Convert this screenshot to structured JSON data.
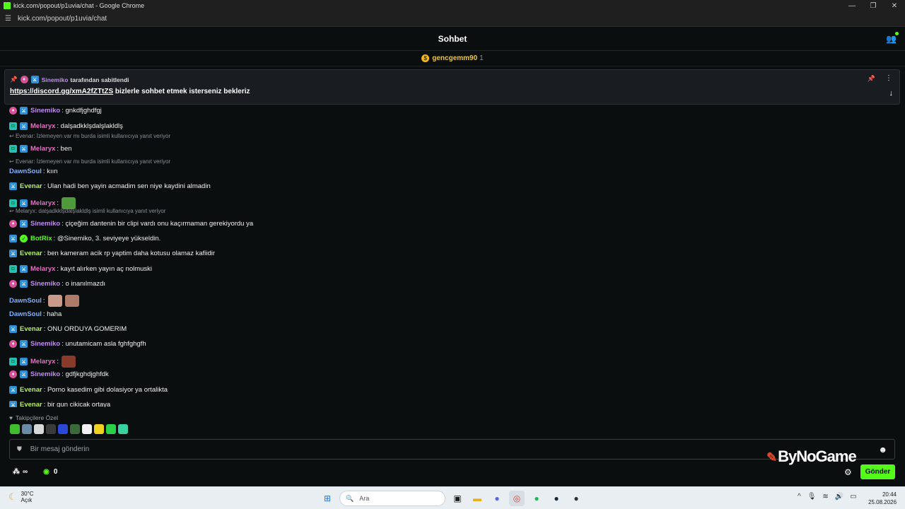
{
  "window": {
    "title": "kick.com/popout/p1uvia/chat - Google Chrome",
    "url": "kick.com/popout/p1uvia/chat"
  },
  "header": {
    "title": "Sohbet"
  },
  "gifter": {
    "name": "gencgemm90",
    "count": "1"
  },
  "pinned": {
    "by_user": "Sinemiko",
    "by_text": "tarafından sabitlendi",
    "link": "https://discord.gg/xmA2fZTtZS",
    "text": " bizlerle sohbet etmek isterseniz bekleriz"
  },
  "messages": [
    {
      "user": "Sinemiko",
      "color": "#c18cf0",
      "text": ": gnkdfjghdfgj",
      "badges": [
        "pink",
        "sword"
      ]
    },
    {
      "user": "Melaryx",
      "color": "#e86cc4",
      "text": ": dalşadkklşdalşlakldlş",
      "badges": [
        "sub",
        "sword"
      ]
    },
    {
      "reply": "Evenar: İzlemeyen var mı burda isimli kullanıcıya yanıt veriyor"
    },
    {
      "user": "Melaryx",
      "color": "#e86cc4",
      "text": ": ben",
      "badges": [
        "sub",
        "sword"
      ]
    },
    {
      "reply": "Evenar: İzlemeyen var mı burda isimli kullanıcıya yanıt veriyor"
    },
    {
      "user": "DawnSoul",
      "color": "#7fb0ff",
      "text": ": kıın",
      "badges": []
    },
    {
      "user": "Evenar",
      "color": "#b6f05a",
      "text": ": Ulan hadi ben yayin acmadim sen niye kaydini almadin",
      "badges": [
        "sword"
      ]
    },
    {
      "user": "Melaryx",
      "color": "#e86cc4",
      "text": ":",
      "badges": [
        "sub",
        "sword"
      ],
      "emote": "#4f9a3a"
    },
    {
      "reply": "Melaryx: dalşadkklşdalşlakldlş isimli kullanıcıya yanıt veriyor"
    },
    {
      "user": "Sinemiko",
      "color": "#c18cf0",
      "text": ": çiçeğim dantenin bir clipi vardı onu kaçırmaman gerekiyordu ya",
      "badges": [
        "pink",
        "sword"
      ]
    },
    {
      "user": "BotRix",
      "color": "#53fc18",
      "text": ": @Sinemiko, 3. seviyeye yükseldin.",
      "badges": [
        "sword",
        "ok"
      ]
    },
    {
      "user": "Evenar",
      "color": "#b6f05a",
      "text": ": ben kameram acik rp yaptim daha kotusu olamaz kafiidir",
      "badges": [
        "sword"
      ]
    },
    {
      "user": "Melaryx",
      "color": "#e86cc4",
      "text": ": kayıt alırken yayın aç nolmuski",
      "badges": [
        "sub",
        "sword"
      ]
    },
    {
      "user": "Sinemiko",
      "color": "#c18cf0",
      "text": ": o inanılmazdı",
      "badges": [
        "pink",
        "sword"
      ]
    },
    {
      "user": "DawnSoul",
      "color": "#7fb0ff",
      "text": ":",
      "badges": [],
      "emote": "#c99a8a",
      "emote2": "#b07a6a"
    },
    {
      "user": "DawnSoul",
      "color": "#7fb0ff",
      "text": ": haha",
      "badges": []
    },
    {
      "user": "Evenar",
      "color": "#b6f05a",
      "text": ": ONU ORDUYA GOMERIM",
      "badges": [
        "sword"
      ]
    },
    {
      "user": "Sinemiko",
      "color": "#c18cf0",
      "text": ": unutamicam asla fghfghgfh",
      "badges": [
        "pink",
        "sword"
      ]
    },
    {
      "user": "Melaryx",
      "color": "#e86cc4",
      "text": ":",
      "badges": [
        "sub",
        "sword"
      ],
      "emote": "#8a3a2a"
    },
    {
      "user": "Sinemiko",
      "color": "#c18cf0",
      "text": ": gdfjkghdjghfdk",
      "badges": [
        "pink",
        "sword"
      ]
    },
    {
      "user": "Evenar",
      "color": "#b6f05a",
      "text": ": Porno kasedim gibi dolasiyor ya ortalikta",
      "badges": [
        "sword"
      ]
    },
    {
      "user": "Evenar",
      "color": "#b6f05a",
      "text": ": bir gun cikicak ortaya",
      "badges": [
        "sword"
      ]
    }
  ],
  "follower_label": "Takipçilere Özel",
  "input": {
    "placeholder": "Bir mesaj gönderin"
  },
  "logo": "ByNoGame",
  "bottom": {
    "infinity": "∞",
    "points": "0",
    "send_label": "Gönder"
  },
  "taskbar": {
    "weather_temp": "30°C",
    "weather_desc": "Açık",
    "search_label": "Ara",
    "time": "20:44",
    "date": "25.08.2026"
  }
}
